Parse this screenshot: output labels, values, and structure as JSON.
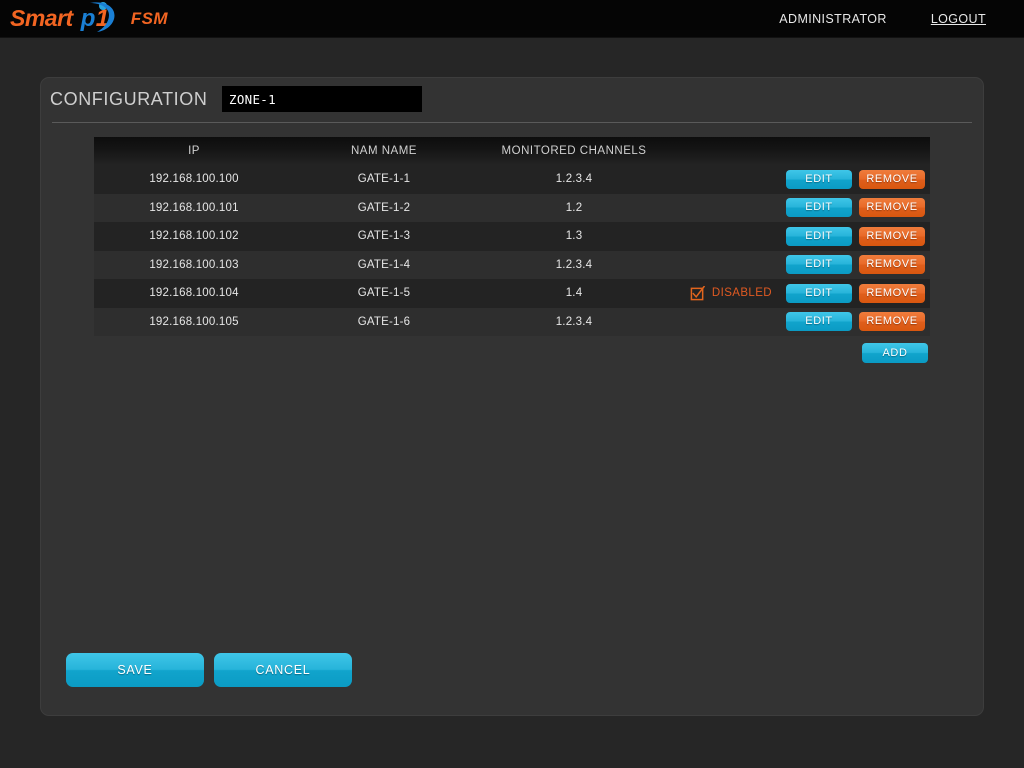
{
  "header": {
    "logo": {
      "part1": "Smart",
      "part_p": "p",
      "part_1": "1",
      "suffix": "FSM"
    },
    "user_label": "ADMINISTRATOR",
    "logout_label": "LOGOUT"
  },
  "panel": {
    "title": "CONFIGURATION",
    "zone_value": "ZONE-1",
    "zone_placeholder": "ZONE-1"
  },
  "table": {
    "columns": [
      "IP",
      "NAM NAME",
      "MONITORED CHANNELS"
    ],
    "rows": [
      {
        "ip": "192.168.100.100",
        "name": "GATE-1-1",
        "channels": "1.2.3.4",
        "flag": "",
        "flag_checked": false,
        "edit_label": "EDIT",
        "remove_label": "REMOVE"
      },
      {
        "ip": "192.168.100.101",
        "name": "GATE-1-2",
        "channels": "1.2",
        "flag": "",
        "flag_checked": false,
        "edit_label": "EDIT",
        "remove_label": "REMOVE"
      },
      {
        "ip": "192.168.100.102",
        "name": "GATE-1-3",
        "channels": "1.3",
        "flag": "",
        "flag_checked": false,
        "edit_label": "EDIT",
        "remove_label": "REMOVE"
      },
      {
        "ip": "192.168.100.103",
        "name": "GATE-1-4",
        "channels": "1.2.3.4",
        "flag": "",
        "flag_checked": false,
        "edit_label": "EDIT",
        "remove_label": "REMOVE"
      },
      {
        "ip": "192.168.100.104",
        "name": "GATE-1-5",
        "channels": "1.4",
        "flag": "DISABLED",
        "flag_checked": true,
        "edit_label": "EDIT",
        "remove_label": "REMOVE"
      },
      {
        "ip": "192.168.100.105",
        "name": "GATE-1-6",
        "channels": "1.2.3.4",
        "flag": "",
        "flag_checked": false,
        "edit_label": "EDIT",
        "remove_label": "REMOVE"
      }
    ],
    "add_label": "ADD"
  },
  "footer": {
    "save_label": "SAVE",
    "cancel_label": "CANCEL"
  },
  "colors": {
    "accent_cyan": "#29b4da",
    "accent_orange": "#e2651e",
    "page_bg": "#262626",
    "panel_bg": "#333333",
    "row_odd": "#232323",
    "row_even": "#2e2e2e"
  }
}
